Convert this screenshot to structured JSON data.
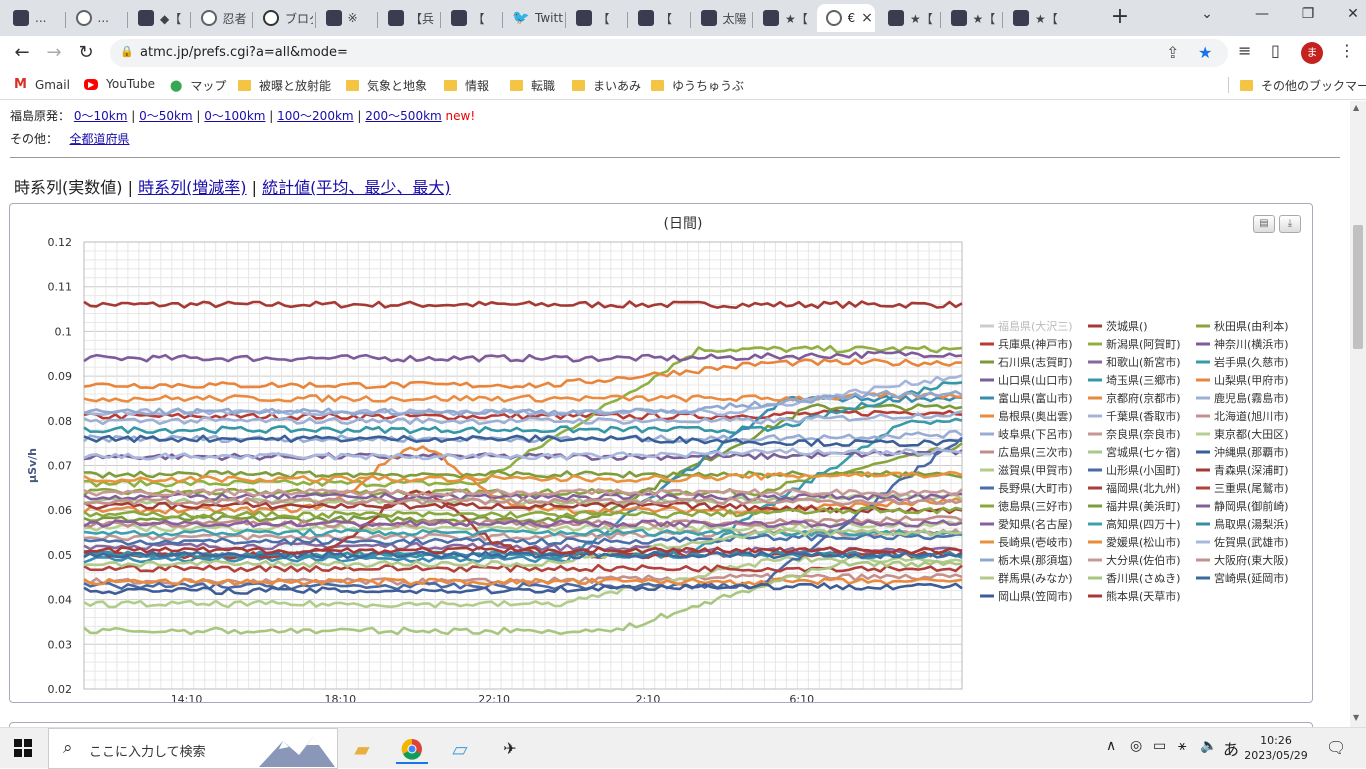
{
  "browser": {
    "tabs": [
      {
        "title": "...",
        "icon": "dark"
      },
      {
        "title": "...",
        "icon": "globe"
      },
      {
        "title": "◆【",
        "icon": "dark"
      },
      {
        "title": "忍者",
        "icon": "globe"
      },
      {
        "title": "ブログ",
        "icon": "circle"
      },
      {
        "title": "※",
        "icon": "dark"
      },
      {
        "title": "【兵",
        "icon": "dark"
      },
      {
        "title": "【",
        "icon": "dark"
      },
      {
        "title": "Twitt",
        "icon": "twitter"
      },
      {
        "title": "【",
        "icon": "dark"
      },
      {
        "title": "【",
        "icon": "dark"
      },
      {
        "title": "太陽",
        "icon": "dark"
      },
      {
        "title": "★【",
        "icon": "dark"
      },
      {
        "title": "€",
        "icon": "globe",
        "active": true
      },
      {
        "title": "★【",
        "icon": "dark"
      },
      {
        "title": "★【",
        "icon": "dark"
      },
      {
        "title": "★【",
        "icon": "dark"
      }
    ],
    "new_tab": "+",
    "url": "atmc.jp/prefs.cgi?a=all&mode=",
    "profile_initial": "ま",
    "bookmarks": [
      {
        "label": "Gmail",
        "icon": "gmail-icon"
      },
      {
        "label": "YouTube",
        "icon": "youtube-icon"
      },
      {
        "label": "マップ",
        "icon": "maps-icon"
      },
      {
        "label": "被曝と放射能",
        "icon": "folder-icon"
      },
      {
        "label": "気象と地象",
        "icon": "folder-icon"
      },
      {
        "label": "情報",
        "icon": "folder-icon"
      },
      {
        "label": "転職",
        "icon": "folder-icon"
      },
      {
        "label": "まいあみ",
        "icon": "folder-icon"
      },
      {
        "label": "ゆうちゅうぶ",
        "icon": "folder-icon"
      }
    ],
    "other_bookmarks": "その他のブックマーク"
  },
  "page": {
    "fukushima_label": "福島原発：",
    "fukushima_links": [
      "0〜10km",
      "0〜50km",
      "0〜100km",
      "100〜200km",
      "200〜500km"
    ],
    "new_label": "new!",
    "other_label": "その他：",
    "other_link": "全都道府県",
    "chart_tabs": {
      "current": "時系列(実数値)",
      "links": [
        "時系列(増減率)",
        "統計値(平均、最少、最大)"
      ]
    }
  },
  "chart_data": {
    "type": "line",
    "title": "(日間)",
    "ylabel": "µSv/h",
    "ylim": [
      0.02,
      0.12
    ],
    "yticks": [
      "0.12",
      "0.11",
      "0.1",
      "0.09",
      "0.08",
      "0.07",
      "0.06",
      "0.05",
      "0.04",
      "0.03",
      "0.02"
    ],
    "xticks": [
      "14:10",
      "18:10",
      "22:10",
      "2:10",
      "6:10"
    ],
    "x_start": "11:30",
    "x_end": "10:20",
    "series": [
      {
        "name": "福島県(大沢三)",
        "color": "#c8c8c8",
        "start": null,
        "end": null,
        "disabled": true
      },
      {
        "name": "茨城県()",
        "color": "#a53a35",
        "start": 0.106,
        "end": 0.106
      },
      {
        "name": "秋田県(由利本)",
        "color": "#8aa33b",
        "start": 0.064,
        "end": 0.075
      },
      {
        "name": "兵庫県(神戸市)",
        "color": "#b83b36",
        "start": 0.081,
        "end": 0.082
      },
      {
        "name": "新潟県(阿賀町)",
        "color": "#8fb040",
        "start": 0.066,
        "end": 0.096
      },
      {
        "name": "神奈川(横浜市)",
        "color": "#7e5a9a",
        "start": 0.094,
        "end": 0.095
      },
      {
        "name": "石川県(志賀町)",
        "color": "#7a9a3a",
        "start": 0.058,
        "end": 0.083
      },
      {
        "name": "和歌山(新宮市)",
        "color": "#87689e",
        "start": 0.052,
        "end": 0.051
      },
      {
        "name": "岩手県(久慈市)",
        "color": "#3a9aa8",
        "start": 0.05,
        "end": 0.08
      },
      {
        "name": "山口県(山口市)",
        "color": "#7a5e98",
        "start": 0.072,
        "end": 0.073
      },
      {
        "name": "埼玉県(三郷市)",
        "color": "#3597a5",
        "start": 0.078,
        "end": 0.091
      },
      {
        "name": "山梨県(甲府市)",
        "color": "#e8853a",
        "start": 0.088,
        "end": 0.093
      },
      {
        "name": "富山県(富山市)",
        "color": "#3a8db0",
        "start": 0.049,
        "end": 0.085
      },
      {
        "name": "京都府(京都市)",
        "color": "#e58a3e",
        "start": 0.06,
        "end": 0.062
      },
      {
        "name": "鹿児島(霧島市)",
        "color": "#9cb0d6",
        "start": 0.08,
        "end": 0.082
      },
      {
        "name": "島根県(奥出雲)",
        "color": "#ea8b40",
        "start": 0.085,
        "end": 0.086
      },
      {
        "name": "千葉県(香取市)",
        "color": "#a4b4da",
        "start": 0.082,
        "end": 0.09
      },
      {
        "name": "北海道(旭川市)",
        "color": "#c4908d",
        "start": 0.044,
        "end": 0.045
      },
      {
        "name": "岐阜県(下呂市)",
        "color": "#98acd4",
        "start": 0.076,
        "end": 0.077
      },
      {
        "name": "奈良県(奈良市)",
        "color": "#c49694",
        "start": 0.054,
        "end": 0.055
      },
      {
        "name": "東京都(大田区)",
        "color": "#b6cf90",
        "start": 0.056,
        "end": 0.057
      },
      {
        "name": "広島県(三次市)",
        "color": "#c08c8a",
        "start": 0.057,
        "end": 0.058
      },
      {
        "name": "宮城県(七ヶ宿)",
        "color": "#aac888",
        "start": 0.062,
        "end": 0.063
      },
      {
        "name": "沖縄県(那覇市)",
        "color": "#3a5f98",
        "start": 0.076,
        "end": 0.075
      },
      {
        "name": "滋賀県(甲賀市)",
        "color": "#b2cc8c",
        "start": 0.039,
        "end": 0.049
      },
      {
        "name": "山形県(小国町)",
        "color": "#4a6aa6",
        "start": 0.043,
        "end": 0.079
      },
      {
        "name": "青森県(深浦町)",
        "color": "#a33a36",
        "start": 0.061,
        "end": 0.06
      },
      {
        "name": "長野県(大町市)",
        "color": "#4a6fa8",
        "start": 0.053,
        "end": 0.054
      },
      {
        "name": "福岡県(北九州)",
        "color": "#aa3e3a",
        "start": 0.05,
        "end": 0.05
      },
      {
        "name": "三重県(尾鷲市)",
        "color": "#b2403c",
        "start": 0.047,
        "end": 0.047
      },
      {
        "name": "徳島県(三好市)",
        "color": "#88a83e",
        "start": 0.059,
        "end": 0.06
      },
      {
        "name": "福井県(美浜町)",
        "color": "#7e9c3a",
        "start": 0.068,
        "end": 0.068
      },
      {
        "name": "静岡県(御前崎)",
        "color": "#806098",
        "start": 0.063,
        "end": 0.063
      },
      {
        "name": "愛知県(名古屋)",
        "color": "#8a5f9c",
        "start": 0.057,
        "end": 0.057
      },
      {
        "name": "高知県(四万十)",
        "color": "#3ea0aa",
        "start": 0.055,
        "end": 0.055
      },
      {
        "name": "鳥取県(湯梨浜)",
        "color": "#3a8ea4",
        "start": 0.05,
        "end": 0.05
      },
      {
        "name": "長崎県(壱岐市)",
        "color": "#e8923e",
        "start": 0.067,
        "end": 0.068
      },
      {
        "name": "愛媛県(松山市)",
        "color": "#e98a3c",
        "start": 0.044,
        "end": 0.044
      },
      {
        "name": "佐賀県(武雄市)",
        "color": "#a8b8dc",
        "start": 0.072,
        "end": 0.073
      },
      {
        "name": "栃木県(那須塩)",
        "color": "#90a8d0",
        "start": 0.082,
        "end": 0.086
      },
      {
        "name": "大分県(佐伯市)",
        "color": "#c89896",
        "start": 0.064,
        "end": 0.064
      },
      {
        "name": "大阪府(東大阪)",
        "color": "#c2928f",
        "start": 0.062,
        "end": 0.062
      },
      {
        "name": "群馬県(みなか)",
        "color": "#b0ca8a",
        "start": 0.048,
        "end": 0.055
      },
      {
        "name": "香川県(さぬき)",
        "color": "#a8c680",
        "start": 0.033,
        "end": 0.048
      },
      {
        "name": "宮崎県(延岡市)",
        "color": "#3a6aa0",
        "start": 0.05,
        "end": 0.05
      },
      {
        "name": "岡山県(笠岡市)",
        "color": "#3e5c96",
        "start": 0.042,
        "end": 0.043
      },
      {
        "name": "熊本県(天草市)",
        "color": "#a83836",
        "start": 0.051,
        "end": 0.051
      }
    ]
  },
  "taskbar": {
    "search_placeholder": "ここに入力して検索",
    "time": "10:26",
    "date": "2023/05/29",
    "ime": "あ"
  }
}
